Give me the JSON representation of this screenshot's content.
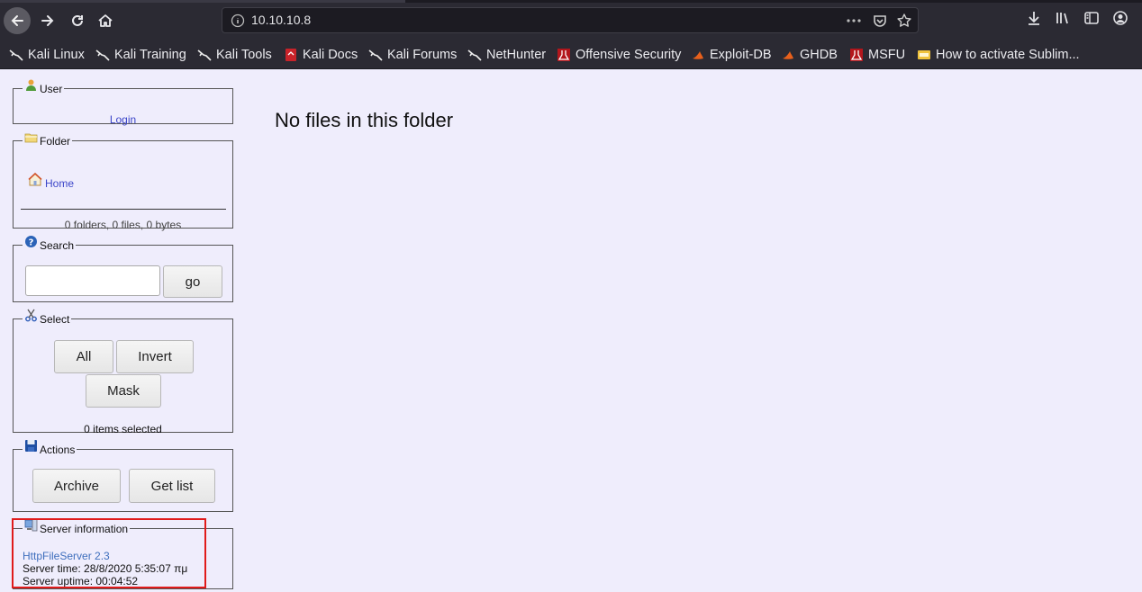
{
  "browser": {
    "url": "10.10.10.8",
    "bookmarks": [
      {
        "label": "Kali Linux",
        "icon": "kali-dragon-icon"
      },
      {
        "label": "Kali Training",
        "icon": "kali-dragon-icon"
      },
      {
        "label": "Kali Tools",
        "icon": "kali-dragon-icon"
      },
      {
        "label": "Kali Docs",
        "icon": "kali-docs-icon"
      },
      {
        "label": "Kali Forums",
        "icon": "kali-dragon-icon"
      },
      {
        "label": "NetHunter",
        "icon": "kali-dragon-icon"
      },
      {
        "label": "Offensive Security",
        "icon": "offsec-icon"
      },
      {
        "label": "Exploit-DB",
        "icon": "exploitdb-icon"
      },
      {
        "label": "GHDB",
        "icon": "exploitdb-icon"
      },
      {
        "label": "MSFU",
        "icon": "offsec-icon"
      },
      {
        "label": "How to activate Sublim...",
        "icon": "sublime-icon"
      }
    ]
  },
  "sidebar": {
    "user": {
      "legend": "User",
      "login": "Login"
    },
    "folder": {
      "legend": "Folder",
      "home": "Home",
      "stats": "0 folders, 0 files, 0 bytes"
    },
    "search": {
      "legend": "Search",
      "go": "go",
      "value": ""
    },
    "select": {
      "legend": "Select",
      "all": "All",
      "invert": "Invert",
      "mask": "Mask",
      "status": "0 items selected"
    },
    "actions": {
      "legend": "Actions",
      "archive": "Archive",
      "get_list": "Get list"
    },
    "server": {
      "legend": "Server information",
      "software": "HttpFileServer 2.3",
      "time": "Server time: 28/8/2020 5:35:07 πμ",
      "uptime": "Server uptime: 00:04:52"
    }
  },
  "main": {
    "message": "No files in this folder"
  },
  "colors": {
    "highlight": "#e01b1b",
    "link": "#3c46c9",
    "page_bg": "#efedfc"
  }
}
